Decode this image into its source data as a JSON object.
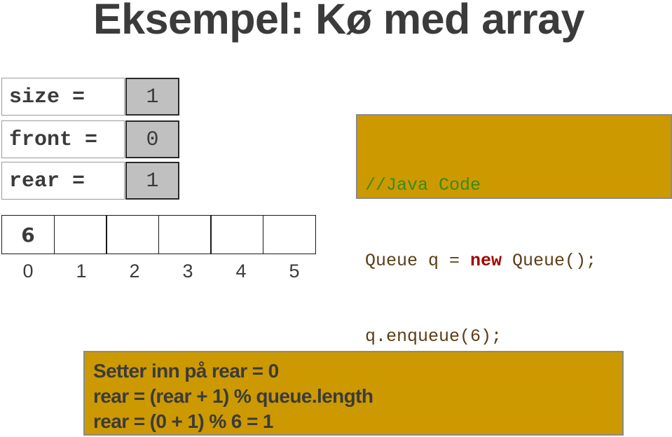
{
  "title": "Eksempel: Kø med array",
  "variables": [
    {
      "label": "size =",
      "value": "1"
    },
    {
      "label": "front =",
      "value": "0"
    },
    {
      "label": "rear =",
      "value": "1"
    }
  ],
  "code": {
    "comment": "//Java Code",
    "line2_pre": "Queue q = ",
    "line2_keyword": "new",
    "line2_post": " Queue();",
    "line3": "q.enqueue(6);"
  },
  "array": {
    "cells": [
      "6",
      "",
      "",
      "",
      "",
      ""
    ],
    "indices": [
      "0",
      "1",
      "2",
      "3",
      "4",
      "5"
    ]
  },
  "explanation": {
    "lines": [
      "Setter inn på rear = 0",
      "rear = (rear + 1) % queue.length",
      "rear = (0 + 1) % 6 = 1"
    ]
  },
  "colors": {
    "box_fill": "#cc9900",
    "value_fill": "#c0c0c0",
    "comment": "#3b8a1a",
    "keyword": "#a50000",
    "text": "#3b3b3b"
  }
}
